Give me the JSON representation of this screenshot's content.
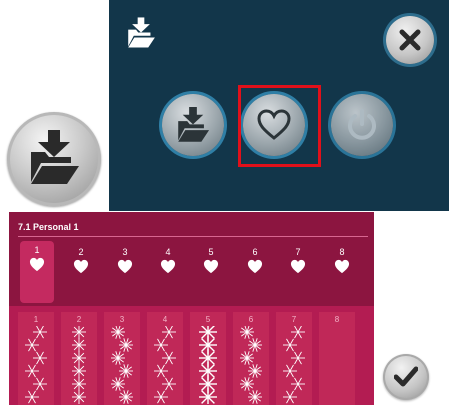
{
  "colors": {
    "panel_bg": "#12364a",
    "highlight_border": "#e0101a",
    "menu_bg": "#b31c52",
    "menu_head_bg": "#8c1540"
  },
  "icons": {
    "standalone": "folder-load-icon",
    "panel_header": "folder-load-icon",
    "close": "close-icon",
    "load": "folder-load-icon",
    "favorites": "heart-icon",
    "power": "power-icon",
    "ok": "check-icon"
  },
  "personal_menu": {
    "title": "7.1 Personal 1",
    "tabs": [
      {
        "number": "1",
        "active": true
      },
      {
        "number": "2",
        "active": false
      },
      {
        "number": "3",
        "active": false
      },
      {
        "number": "4",
        "active": false
      },
      {
        "number": "5",
        "active": false
      },
      {
        "number": "6",
        "active": false
      },
      {
        "number": "7",
        "active": false
      },
      {
        "number": "8",
        "active": false
      }
    ],
    "stitch_columns": [
      {
        "number": "1"
      },
      {
        "number": "2"
      },
      {
        "number": "3"
      },
      {
        "number": "4"
      },
      {
        "number": "5"
      },
      {
        "number": "6"
      },
      {
        "number": "7"
      },
      {
        "number": "8"
      }
    ]
  }
}
